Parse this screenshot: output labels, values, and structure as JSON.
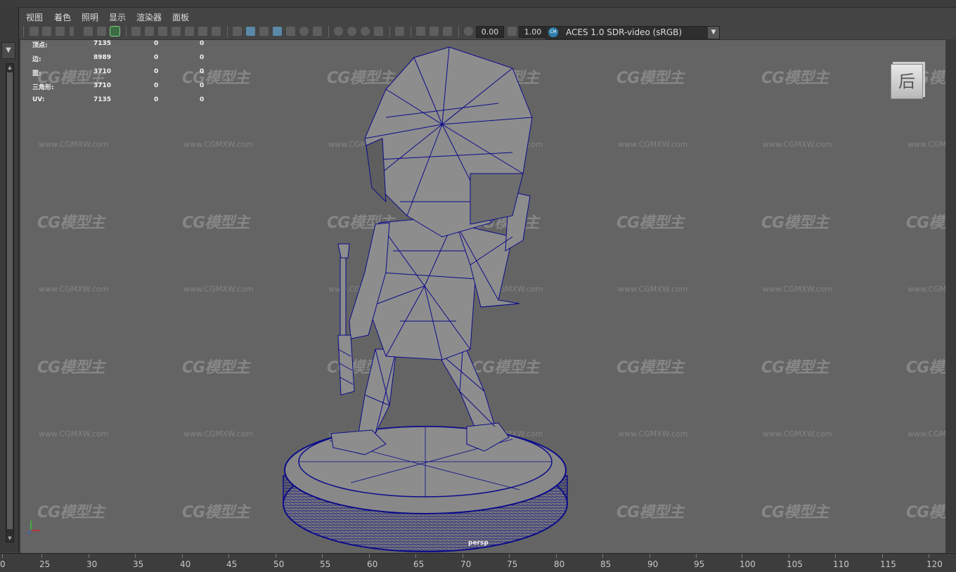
{
  "menu": {
    "items": [
      "视图",
      "着色",
      "照明",
      "显示",
      "渲染器",
      "面板"
    ]
  },
  "toolbar": {
    "exposure_value": "0.00",
    "gamma_value": "1.00",
    "color_space": "ACES 1.0 SDR-video (sRGB)",
    "color_space_icon": "CM"
  },
  "heads_up": {
    "rows": [
      {
        "label": "顶点:",
        "v1": "7135",
        "v2": "0",
        "v3": "0"
      },
      {
        "label": "边:",
        "v1": "8989",
        "v2": "0",
        "v3": "0"
      },
      {
        "label": "面:",
        "v1": "3710",
        "v2": "0",
        "v3": "0"
      },
      {
        "label": "三角形:",
        "v1": "3710",
        "v2": "0",
        "v3": "0"
      },
      {
        "label": "UV:",
        "v1": "7135",
        "v2": "0",
        "v3": "0"
      }
    ]
  },
  "viewport": {
    "camera_label": "persp",
    "view_cube_label": "后",
    "watermark_logo": "CG模型主",
    "watermark_url": "www.CGMXW.com",
    "axis_y": "y",
    "axis_x": "x",
    "axis_z": "z"
  },
  "timeline": {
    "ticks": [
      "0",
      "25",
      "30",
      "35",
      "40",
      "45",
      "50",
      "55",
      "60",
      "65",
      "70",
      "75",
      "80",
      "85",
      "90",
      "95",
      "100",
      "105",
      "110",
      "115",
      "120"
    ]
  },
  "colors": {
    "viewport_bg": "#646464",
    "wireframe": "#0c0c8a",
    "mesh_fill": "#8d8d8d",
    "active_button": "#5a89a8"
  }
}
